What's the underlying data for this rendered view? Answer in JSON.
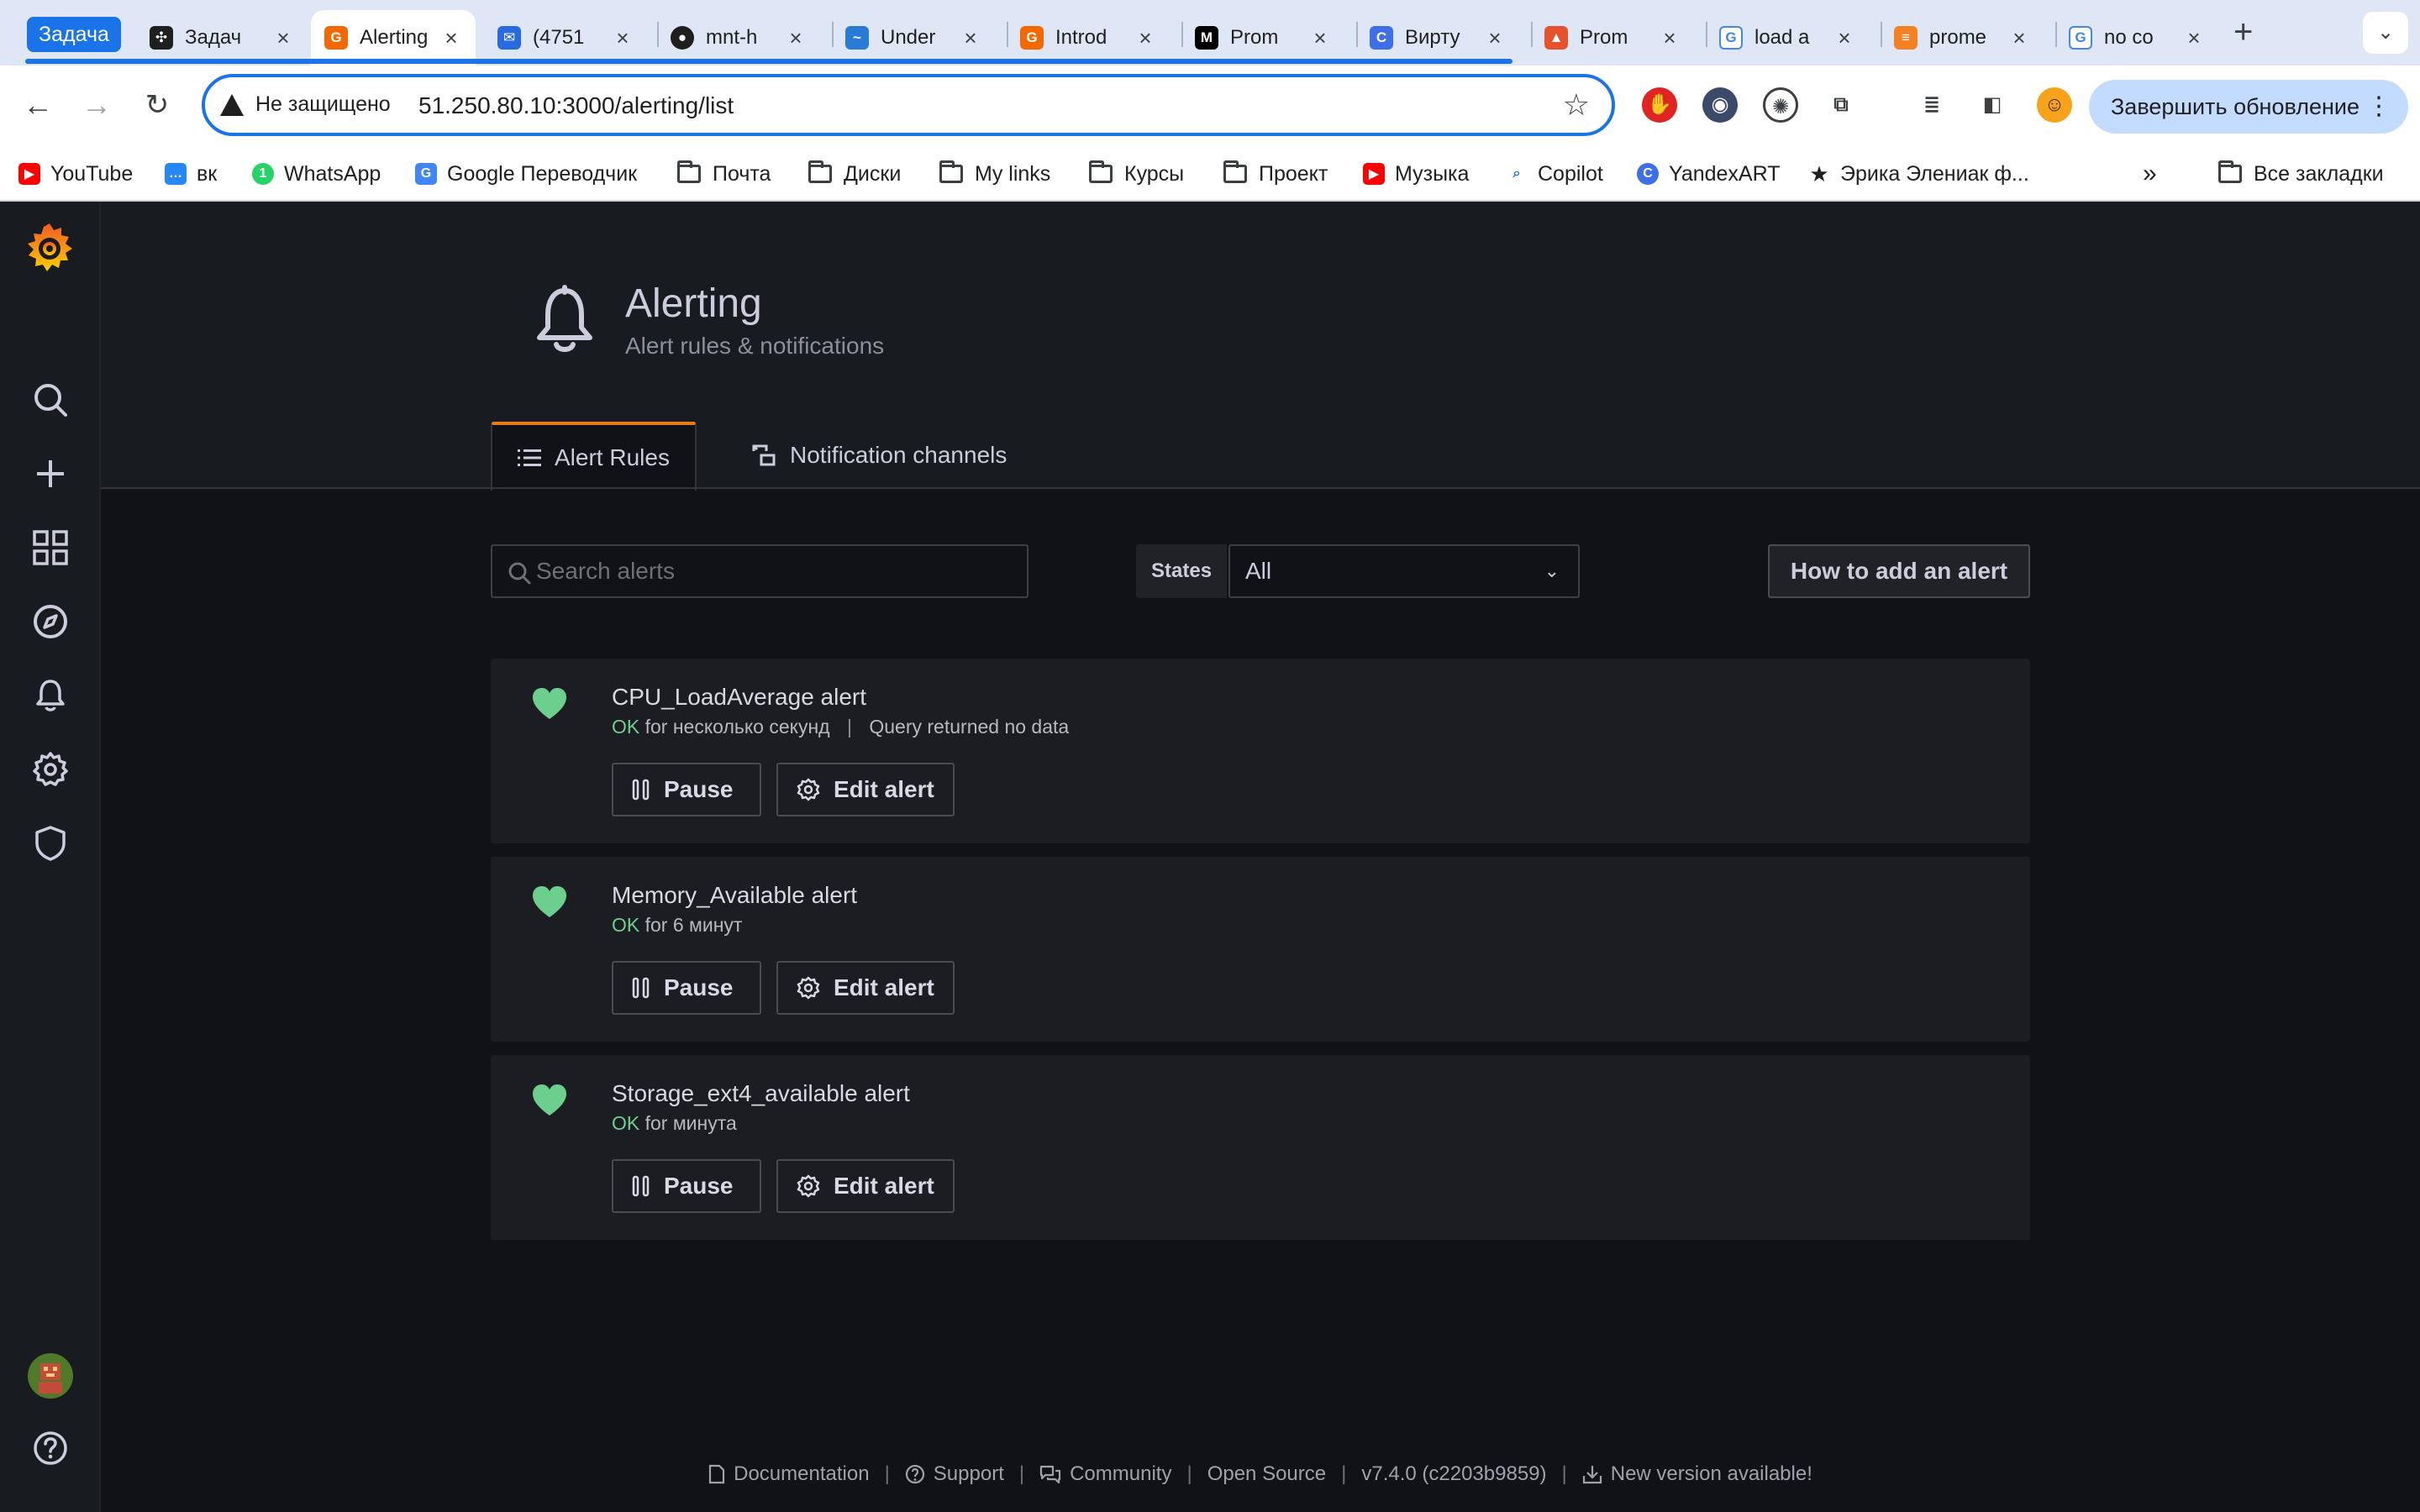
{
  "browser": {
    "tab_group_label": "Задача",
    "tabs": [
      {
        "title": "Задач",
        "active": false,
        "favicon": "puzzle-icon"
      },
      {
        "title": "Alerting",
        "active": true,
        "favicon": "grafana-icon"
      },
      {
        "title": "(4751",
        "active": false,
        "favicon": "mail-icon"
      },
      {
        "title": "mnt-h",
        "active": false,
        "favicon": "github-icon"
      },
      {
        "title": "Under",
        "active": false,
        "favicon": "chart-icon"
      },
      {
        "title": "Introd",
        "active": false,
        "favicon": "grafana-icon"
      },
      {
        "title": "Prom",
        "active": false,
        "favicon": "medium-icon"
      },
      {
        "title": "Вирту",
        "active": false,
        "favicon": "c-icon"
      },
      {
        "title": "Prom",
        "active": false,
        "favicon": "flame-icon"
      },
      {
        "title": "load a",
        "active": false,
        "favicon": "google-icon"
      },
      {
        "title": "prome",
        "active": false,
        "favicon": "stackoverflow-icon"
      },
      {
        "title": "no co",
        "active": false,
        "favicon": "google-icon"
      }
    ],
    "security_label": "Не защищено",
    "url": "51.250.80.10:3000/alerting/list",
    "update_button": "Завершить обновление",
    "bookmarks": [
      {
        "label": "YouTube",
        "icon": "youtube-icon"
      },
      {
        "label": "вк",
        "icon": "chat-icon"
      },
      {
        "label": "WhatsApp",
        "icon": "whatsapp-icon"
      },
      {
        "label": "Google Переводчик",
        "icon": "translate-icon"
      },
      {
        "label": "Почта",
        "icon": "folder-icon"
      },
      {
        "label": "Диски",
        "icon": "folder-icon"
      },
      {
        "label": "My links",
        "icon": "folder-icon"
      },
      {
        "label": "Курсы",
        "icon": "folder-icon"
      },
      {
        "label": "Проект",
        "icon": "folder-icon"
      },
      {
        "label": "Музыка",
        "icon": "youtube-icon"
      },
      {
        "label": "Copilot",
        "icon": "search-icon"
      },
      {
        "label": "YandexART",
        "icon": "c-icon"
      },
      {
        "label": "Эрика Элениак ф...",
        "icon": "star-icon"
      }
    ],
    "all_bookmarks": "Все закладки"
  },
  "page": {
    "title": "Alerting",
    "subtitle": "Alert rules & notifications",
    "tabs": [
      {
        "label": "Alert Rules",
        "active": true
      },
      {
        "label": "Notification channels",
        "active": false
      }
    ]
  },
  "filters": {
    "search_placeholder": "Search alerts",
    "states_label": "States",
    "states_value": "All",
    "how_to_button": "How to add an alert"
  },
  "alerts": [
    {
      "name": "CPU_LoadAverage alert",
      "state": "OK",
      "duration": "for несколько секунд",
      "info": "Query returned no data",
      "pause": "Pause",
      "edit": "Edit alert"
    },
    {
      "name": "Memory_Available alert",
      "state": "OK",
      "duration": "for 6 минут",
      "info": "",
      "pause": "Pause",
      "edit": "Edit alert"
    },
    {
      "name": "Storage_ext4_available alert",
      "state": "OK",
      "duration": "for минута",
      "info": "",
      "pause": "Pause",
      "edit": "Edit alert"
    }
  ],
  "footer": {
    "documentation": "Documentation",
    "support": "Support",
    "community": "Community",
    "open_source": "Open Source",
    "version": "v7.4.0 (c2203b9859)",
    "new_version": "New version available!"
  },
  "colors": {
    "accent": "#eb7b18",
    "ok": "#6ccf8e",
    "browser_blue": "#1a73e8"
  }
}
